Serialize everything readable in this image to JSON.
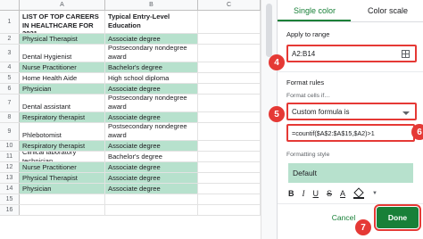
{
  "sheet": {
    "columns": [
      "A",
      "B",
      "C"
    ],
    "rows": [
      {
        "num": "1",
        "a": "LIST OF TOP CAREERS IN HEALTHCARE FOR 2021",
        "b": "Typical Entry-Level Education",
        "hl": false,
        "header": true
      },
      {
        "num": "2",
        "a": "Physical Therapist",
        "b": "Associate degree",
        "hl": true
      },
      {
        "num": "3",
        "a": "Dental Hygienist",
        "b": "Postsecondary nondegree award",
        "hl": false
      },
      {
        "num": "4",
        "a": "Nurse Practitioner",
        "b": "Bachelor's degree",
        "hl": true
      },
      {
        "num": "5",
        "a": "Home Health Aide",
        "b": "High school diploma",
        "hl": false
      },
      {
        "num": "6",
        "a": "Physician",
        "b": "Associate degree",
        "hl": true
      },
      {
        "num": "7",
        "a": "Dental assistant",
        "b": "Postsecondary nondegree award",
        "hl": false
      },
      {
        "num": "8",
        "a": "Respiratory therapist",
        "b": "Associate degree",
        "hl": true
      },
      {
        "num": "9",
        "a": "Phlebotomist",
        "b": "Postsecondary nondegree award",
        "hl": false
      },
      {
        "num": "10",
        "a": "Respiratory therapist",
        "b": "Associate degree",
        "hl": true
      },
      {
        "num": "11",
        "a": "Clinical laboratory technician",
        "b": "Bachelor's degree",
        "hl": false
      },
      {
        "num": "12",
        "a": "Nurse Practitioner",
        "b": "Associate degree",
        "hl": true
      },
      {
        "num": "13",
        "a": "Physical Therapist",
        "b": "Associate degree",
        "hl": true
      },
      {
        "num": "14",
        "a": "Physician",
        "b": "Associate degree",
        "hl": true
      },
      {
        "num": "15",
        "a": "",
        "b": "",
        "hl": false
      },
      {
        "num": "16",
        "a": "",
        "b": "",
        "hl": false
      }
    ]
  },
  "panel": {
    "tab_single": "Single color",
    "tab_scale": "Color scale",
    "apply_label": "Apply to range",
    "range_value": "A2:B14",
    "format_rules_label": "Format rules",
    "format_cells_if": "Format cells if…",
    "condition_value": "Custom formula is",
    "formula_value": "=countif($A$2:$A$15,$A2)>1",
    "formatting_style_label": "Formatting style",
    "style_preview": "Default",
    "fmt_bold": "B",
    "fmt_italic": "I",
    "fmt_underline": "U",
    "fmt_strike": "S",
    "fmt_text_color": "A",
    "cancel": "Cancel",
    "done": "Done"
  },
  "callouts": [
    "4",
    "5",
    "6",
    "7"
  ],
  "colors": {
    "highlight": "#b7e1cd",
    "accent": "#188038",
    "callout": "#e53935"
  }
}
